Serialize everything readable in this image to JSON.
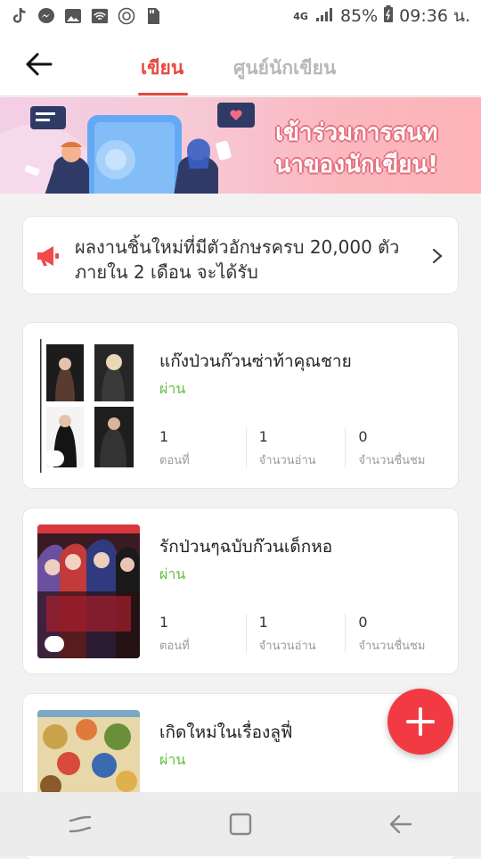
{
  "status_bar": {
    "network": "4G",
    "battery": "85%",
    "time": "09:36 น."
  },
  "header": {
    "tabs": [
      {
        "label": "เขียน",
        "active": true
      },
      {
        "label": "ศูนย์นักเขียน",
        "active": false
      }
    ]
  },
  "banner": {
    "line1": "เข้าร่วมการสนท",
    "line2": "นาของนักเขียน!"
  },
  "notice": {
    "text": "ผลงานชิ้นใหม่ที่มีตัวอักษรครบ 20,000 ตัวภายใน 2 เดือน จะได้รับ"
  },
  "stories": [
    {
      "title": "แก๊งป่วนก๊วนซ่าท้าคุณชาย",
      "status": "ผ่าน",
      "stats": [
        {
          "value": "1",
          "label": "ตอนที่"
        },
        {
          "value": "1",
          "label": "จำนวนอ่าน"
        },
        {
          "value": "0",
          "label": "จำนวนชื่นชม"
        }
      ]
    },
    {
      "title": "รักป่วนๆฉบับก๊วนเด็กหอ",
      "status": "ผ่าน",
      "stats": [
        {
          "value": "1",
          "label": "ตอนที่"
        },
        {
          "value": "1",
          "label": "จำนวนอ่าน"
        },
        {
          "value": "0",
          "label": "จำนวนชื่นชม"
        }
      ]
    },
    {
      "title": "เกิดใหม่ในเรื่องลูฟี่",
      "status": "ผ่าน"
    }
  ],
  "colors": {
    "accent": "#e8483f",
    "status_ok": "#5fbf3f",
    "fab": "#f23a43"
  }
}
